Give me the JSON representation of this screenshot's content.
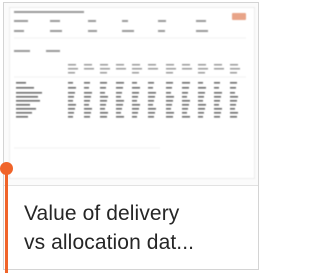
{
  "card": {
    "title": "Value of delivery\nvs allocation dat..."
  },
  "colors": {
    "accent": "#f0642a",
    "card_border": "#d4d4d4",
    "title_text": "#262626"
  },
  "icons": {
    "accent_marker": "orange-dot-stem-icon"
  }
}
